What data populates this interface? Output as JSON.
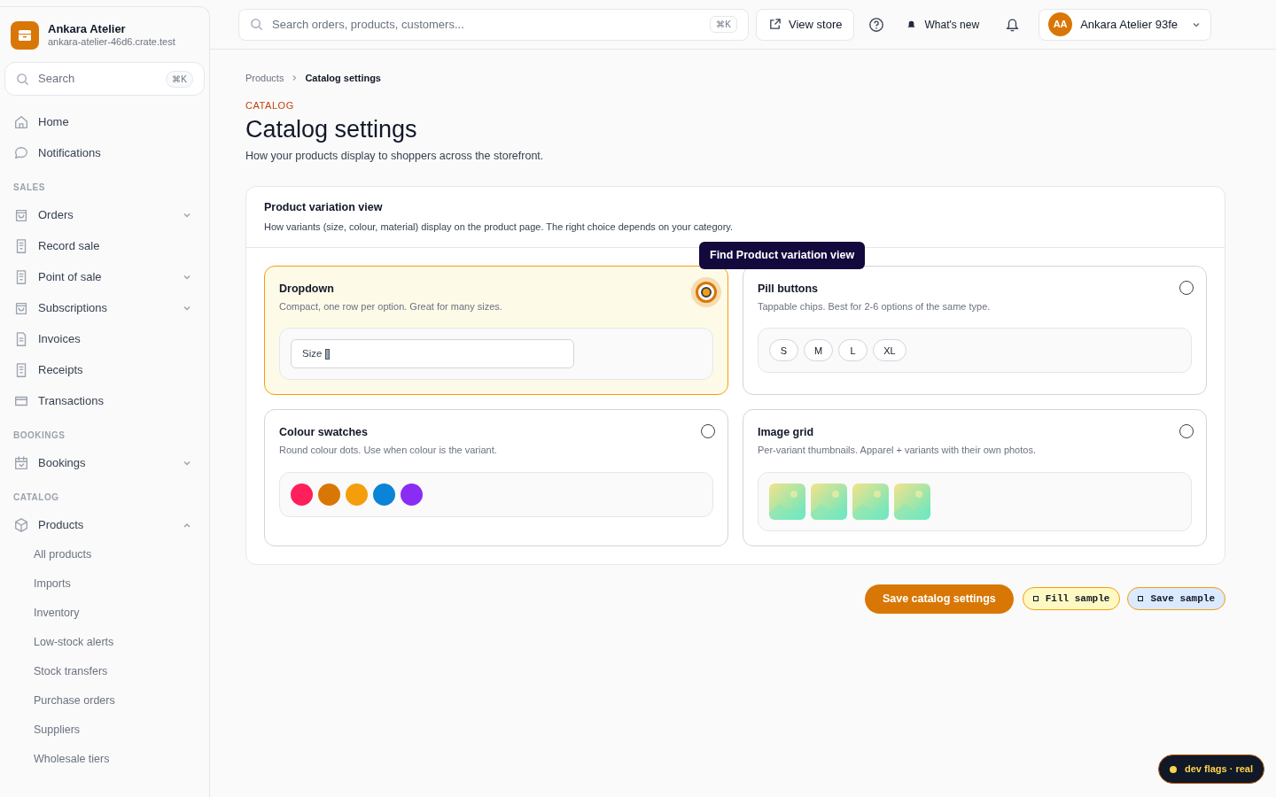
{
  "brand": {
    "name": "Ankara Atelier",
    "domain": "ankara-atelier-46d6.crate.test"
  },
  "sidebar_search": {
    "placeholder": "Search",
    "shortcut": "⌘K"
  },
  "sidebar": [
    {
      "items": [
        {
          "label": "Home"
        },
        {
          "label": "Notifications"
        }
      ]
    },
    {
      "heading": "SALES",
      "items": [
        {
          "label": "Orders",
          "expanded": false
        },
        {
          "label": "Record sale"
        },
        {
          "label": "Point of sale",
          "expanded": false
        },
        {
          "label": "Subscriptions",
          "expanded": false
        },
        {
          "label": "Invoices"
        },
        {
          "label": "Receipts"
        },
        {
          "label": "Transactions"
        }
      ]
    },
    {
      "heading": "BOOKINGS",
      "items": [
        {
          "label": "Bookings",
          "expanded": false
        }
      ]
    },
    {
      "heading": "CATALOG",
      "items": [
        {
          "label": "Products",
          "expanded": true,
          "children": [
            {
              "label": "All products"
            },
            {
              "label": "Imports"
            },
            {
              "label": "Inventory"
            },
            {
              "label": "Low-stock alerts"
            },
            {
              "label": "Stock transfers"
            },
            {
              "label": "Purchase orders"
            },
            {
              "label": "Suppliers"
            },
            {
              "label": "Wholesale tiers"
            }
          ]
        }
      ]
    }
  ],
  "topbar": {
    "search": {
      "placeholder": "Search orders, products, customers...",
      "shortcut": "⌘K"
    },
    "view_store": "View store",
    "whats_new": "What's new",
    "account": {
      "initials": "AA",
      "name": "Ankara Atelier 93fe"
    }
  },
  "breadcrumb": [
    "Products",
    "Catalog settings"
  ],
  "eyebrow": "CATALOG",
  "title": "Catalog settings",
  "subtitle": "How your products display to shoppers across the storefront.",
  "section": {
    "title": "Product variation view",
    "description": "How variants (size, colour, material) display on the product page. The right choice depends on your category.",
    "options": [
      {
        "kind": "dropdown",
        "title": "Dropdown",
        "description": "Compact, one row per option. Great for many sizes.",
        "selected": true,
        "field_value": "Size"
      },
      {
        "kind": "pills",
        "title": "Pill buttons",
        "description": "Tappable chips. Best for 2-6 options of the same type.",
        "selected": false,
        "pills": [
          "S",
          "M",
          "L",
          "XL"
        ]
      },
      {
        "kind": "swatches",
        "title": "Colour swatches",
        "description": "Round colour dots. Use when colour is the variant.",
        "selected": false,
        "swatches": [
          {
            "color": "#ff1f5a"
          },
          {
            "color": "#d97706"
          },
          {
            "color": "#f59e0b"
          },
          {
            "color": "#0a84d6"
          },
          {
            "color": "#8b2cf5"
          }
        ]
      },
      {
        "kind": "images",
        "title": "Image grid",
        "description": "Per-variant thumbnails. Apparel + variants with their own photos.",
        "selected": false
      }
    ]
  },
  "tooltip": "Find Product variation view",
  "actions": {
    "save": "Save catalog settings",
    "fill_sample": "Fill sample",
    "save_sample": "Save sample"
  },
  "dev_badge": "dev flags · real"
}
